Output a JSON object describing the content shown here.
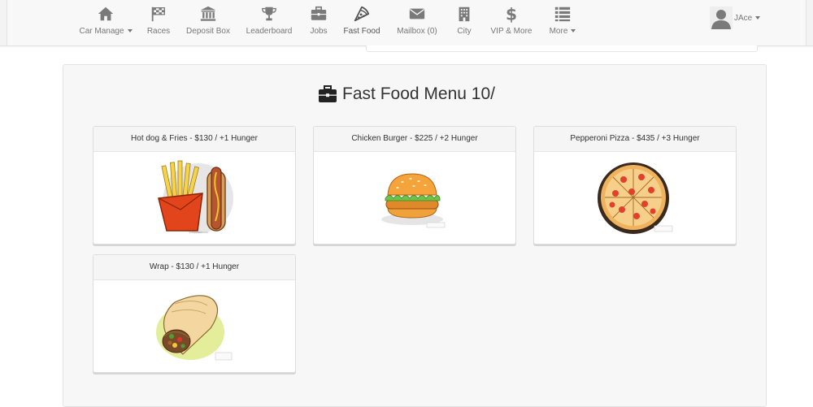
{
  "nav": {
    "items": [
      {
        "label": "Car Manage",
        "icon": "home-icon",
        "dropdown": true
      },
      {
        "label": "Races",
        "icon": "flag-icon",
        "dropdown": false
      },
      {
        "label": "Deposit Box",
        "icon": "bank-icon",
        "dropdown": false
      },
      {
        "label": "Leaderboard",
        "icon": "trophy-icon",
        "dropdown": false
      },
      {
        "label": "Jobs",
        "icon": "briefcase-icon",
        "dropdown": false
      },
      {
        "label": "Fast Food",
        "icon": "pizza-slice-icon",
        "dropdown": false
      },
      {
        "label": "Mailbox (0)",
        "icon": "envelope-icon",
        "dropdown": false
      },
      {
        "label": "City",
        "icon": "building-icon",
        "dropdown": false
      },
      {
        "label": "VIP & More",
        "icon": "dollar-icon",
        "dropdown": false
      },
      {
        "label": "More",
        "icon": "list-icon",
        "dropdown": true
      }
    ],
    "user": {
      "name": "JAce",
      "icon": "user-avatar-icon"
    }
  },
  "page": {
    "title": "Fast Food Menu 10/",
    "title_icon": "briefcase-icon"
  },
  "menu": [
    {
      "label": "Hot dog & Fries - $130 / +1 Hunger",
      "image": "hotdog-fries-image"
    },
    {
      "label": "Chicken Burger - $225 / +2 Hunger",
      "image": "chicken-burger-image"
    },
    {
      "label": "Pepperoni Pizza - $435 / +3 Hunger",
      "image": "pepperoni-pizza-image"
    },
    {
      "label": "Wrap - $130 / +1 Hunger",
      "image": "wrap-image"
    }
  ],
  "colors": {
    "navbar_bg": "#f8f8f8",
    "nav_text": "#777777",
    "panel_bg": "#f7f7f7",
    "card_header_bg": "#f5f5f5"
  }
}
